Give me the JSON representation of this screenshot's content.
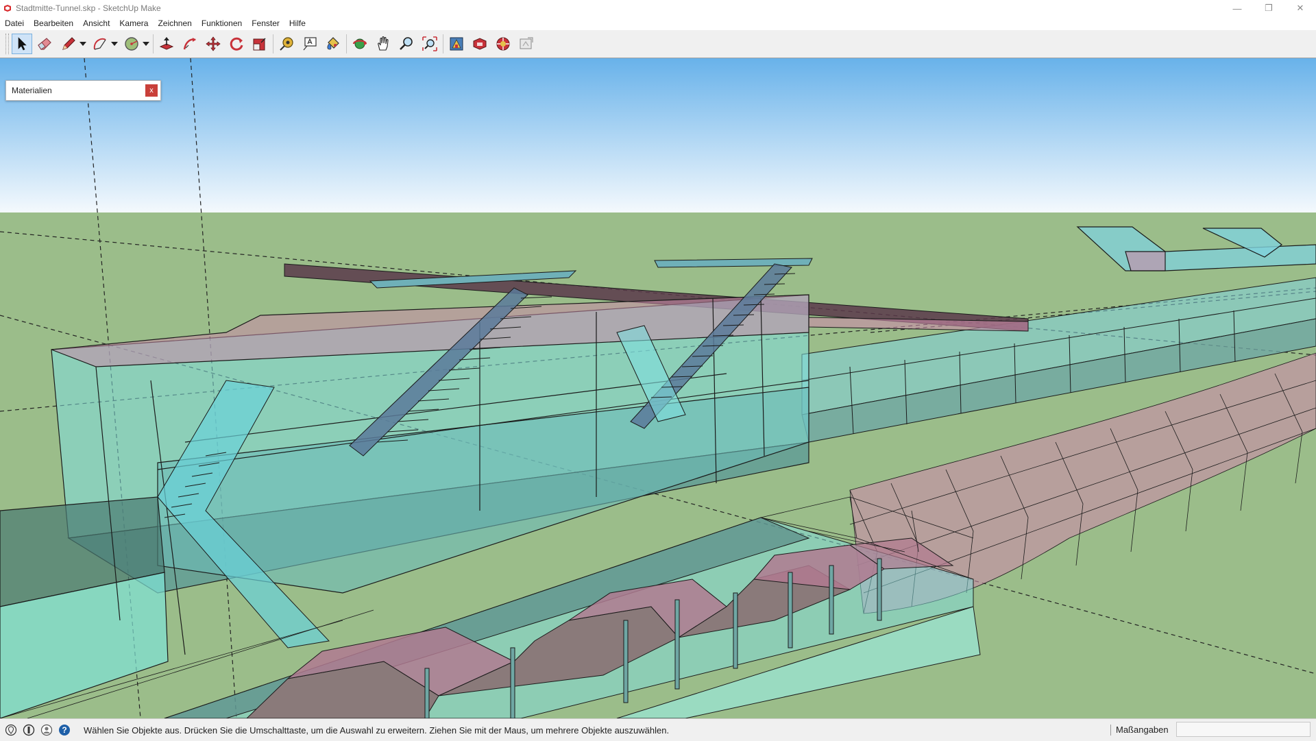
{
  "window": {
    "title": "Stadtmitte-Tunnel.skp - SketchUp Make",
    "app_icon": "sketchup-icon",
    "controls": {
      "minimize": "—",
      "restore": "❐",
      "close": "✕"
    }
  },
  "menu": {
    "items": [
      "Datei",
      "Bearbeiten",
      "Ansicht",
      "Kamera",
      "Zeichnen",
      "Funktionen",
      "Fenster",
      "Hilfe"
    ]
  },
  "toolbar": {
    "tools": [
      {
        "name": "select-tool",
        "icon": "arrow-cursor-icon",
        "active": true
      },
      {
        "name": "eraser-tool",
        "icon": "eraser-icon"
      },
      {
        "name": "line-tool",
        "icon": "pencil-icon",
        "dropdown": true
      },
      {
        "name": "arc-tool",
        "icon": "arc-icon",
        "dropdown": true
      },
      {
        "name": "shape-tool",
        "icon": "circle-icon",
        "dropdown": true
      },
      {
        "name": "push-pull-tool",
        "icon": "push-pull-icon"
      },
      {
        "name": "follow-me-tool",
        "icon": "follow-me-icon"
      },
      {
        "name": "move-tool",
        "icon": "move-icon"
      },
      {
        "name": "rotate-tool",
        "icon": "rotate-icon"
      },
      {
        "name": "scale-tool",
        "icon": "scale-icon"
      },
      {
        "name": "tape-measure-tool",
        "icon": "tape-measure-icon"
      },
      {
        "name": "text-tool",
        "icon": "text-icon"
      },
      {
        "name": "paint-bucket-tool",
        "icon": "paint-bucket-icon"
      },
      {
        "name": "orbit-tool",
        "icon": "orbit-icon"
      },
      {
        "name": "pan-tool",
        "icon": "hand-icon"
      },
      {
        "name": "zoom-tool",
        "icon": "magnifier-icon"
      },
      {
        "name": "zoom-extents-tool",
        "icon": "zoom-extents-icon"
      },
      {
        "name": "warehouse-tool",
        "icon": "warehouse-icon"
      },
      {
        "name": "extension-tool",
        "icon": "extension-icon"
      },
      {
        "name": "extension-warehouse-tool",
        "icon": "extension-warehouse-icon"
      },
      {
        "name": "layout-tool",
        "icon": "layout-icon"
      }
    ]
  },
  "materials_panel": {
    "title": "Materialien",
    "close_label": "x"
  },
  "statusbar": {
    "icons": [
      "geo-location-icon",
      "credits-icon",
      "user-icon",
      "help-icon"
    ],
    "help_glyph": "?",
    "message": "Wählen Sie Objekte aus. Drücken Sie die Umschalttaste, um die Auswahl zu erweitern. Ziehen Sie mit der Maus, um mehrere Objekte auszuwählen.",
    "measurements_label": "Maßangaben",
    "measurements_value": ""
  },
  "colors": {
    "sky_top": "#68b2ea",
    "sky_bottom": "#f4f9fd",
    "ground": "#9bbd8a",
    "glass_cyan": "#7fdede",
    "glass_pink": "#c98aa8",
    "edge": "#1a1a1a"
  }
}
